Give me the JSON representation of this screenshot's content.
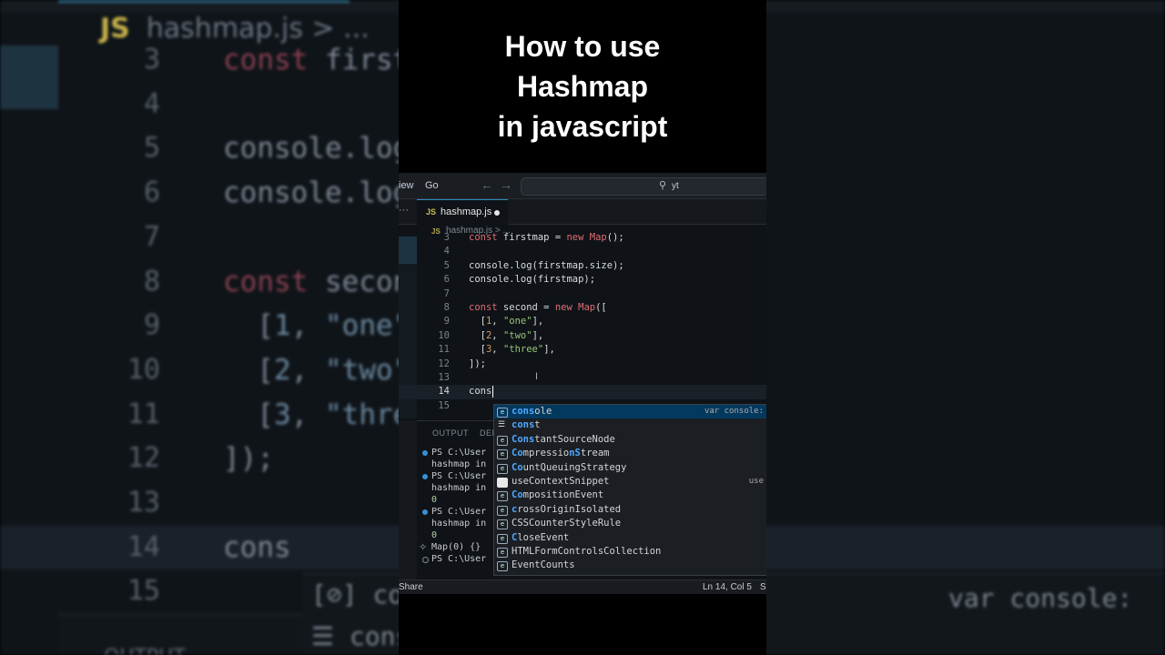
{
  "video_title": {
    "line1": "How to use",
    "line2": "Hashmap",
    "line3": "in javascript"
  },
  "menubar": {
    "view": "iew",
    "go": "Go",
    "back_arrow": "←",
    "forward_arrow": "→",
    "search_text": "yt"
  },
  "tabs": {
    "more": "···",
    "active": {
      "badge": "JS",
      "name": "hashmap.js"
    }
  },
  "breadcrumb": {
    "badge": "JS",
    "file": "hashmap.js",
    "sep": "> ..."
  },
  "editor": {
    "lines": [
      {
        "n": "3",
        "text": "const firstmap = new Map();"
      },
      {
        "n": "4",
        "text": ""
      },
      {
        "n": "5",
        "text": "console.log(firstmap.size);"
      },
      {
        "n": "6",
        "text": "console.log(firstmap);"
      },
      {
        "n": "7",
        "text": ""
      },
      {
        "n": "8",
        "text": "const second = new Map(["
      },
      {
        "n": "9",
        "text": "  [1, \"one\"],"
      },
      {
        "n": "10",
        "text": "  [2, \"two\"],"
      },
      {
        "n": "11",
        "text": "  [3, \"three\"],"
      },
      {
        "n": "12",
        "text": "]);"
      },
      {
        "n": "13",
        "text": ""
      },
      {
        "n": "14",
        "text": "cons"
      },
      {
        "n": "15",
        "text": ""
      }
    ]
  },
  "panel": {
    "output_tab": "OUTPUT",
    "debug_tab": "DEB",
    "terminal": [
      {
        "text": "PS C:\\User",
        "bullet": "blue"
      },
      {
        "text": "hashmap in",
        "bullet": ""
      },
      {
        "text": "PS C:\\User",
        "bullet": "blue"
      },
      {
        "text": "hashmap in",
        "bullet": ""
      },
      {
        "text": "0",
        "bullet": ""
      },
      {
        "text": "PS C:\\User",
        "bullet": "blue"
      },
      {
        "text": "hashmap in",
        "bullet": ""
      },
      {
        "text": "0",
        "bullet": ""
      },
      {
        "text": "Map(0) {}",
        "bullet": ""
      },
      {
        "text": "PS C:\\User",
        "bullet": "hollow"
      }
    ]
  },
  "suggestions": [
    {
      "match": "cons",
      "rest": "ole",
      "detail": "var console:",
      "icon": "var"
    },
    {
      "match": "cons",
      "rest": "t",
      "detail": "",
      "icon": "kw"
    },
    {
      "match": "Cons",
      "rest": "tantSourceNode",
      "detail": "",
      "icon": "var"
    },
    {
      "match": "Co",
      "rest": "mpressio",
      "rest2": "nS",
      "rest3": "tream",
      "detail": "",
      "icon": "var"
    },
    {
      "match": "Co",
      "rest": "untQueuingStrategy",
      "detail": "",
      "icon": "var"
    },
    {
      "match": "",
      "rest": "useContextSnippet",
      "detail": "use",
      "icon": "box"
    },
    {
      "match": "Co",
      "rest": "mpositionEvent",
      "detail": "",
      "icon": "var"
    },
    {
      "match": "c",
      "rest": "rossOriginIsolated",
      "detail": "",
      "icon": "var"
    },
    {
      "match": "",
      "rest": "CSSCounterStyleRule",
      "detail": "",
      "icon": "var"
    },
    {
      "match": "C",
      "rest": "loseEvent",
      "detail": "",
      "icon": "var"
    },
    {
      "match": "",
      "rest": "HTMLFormControlsCollection",
      "detail": "",
      "icon": "var"
    },
    {
      "match": "",
      "rest": "EventCounts",
      "detail": "",
      "icon": "var"
    }
  ],
  "statusbar": {
    "left": "Share",
    "position": "Ln 14, Col 5",
    "right": "Sp"
  },
  "colors": {
    "accent": "#2e8bc0",
    "keyword": "#e06c75",
    "string": "#98c379",
    "number": "#d19a66",
    "suggest_highlight": "#4fa8ff",
    "selected_row": "#04395e"
  },
  "background_zoom": {
    "crumb": "hashmap.js > ...",
    "suggest_detail": "var console:"
  }
}
